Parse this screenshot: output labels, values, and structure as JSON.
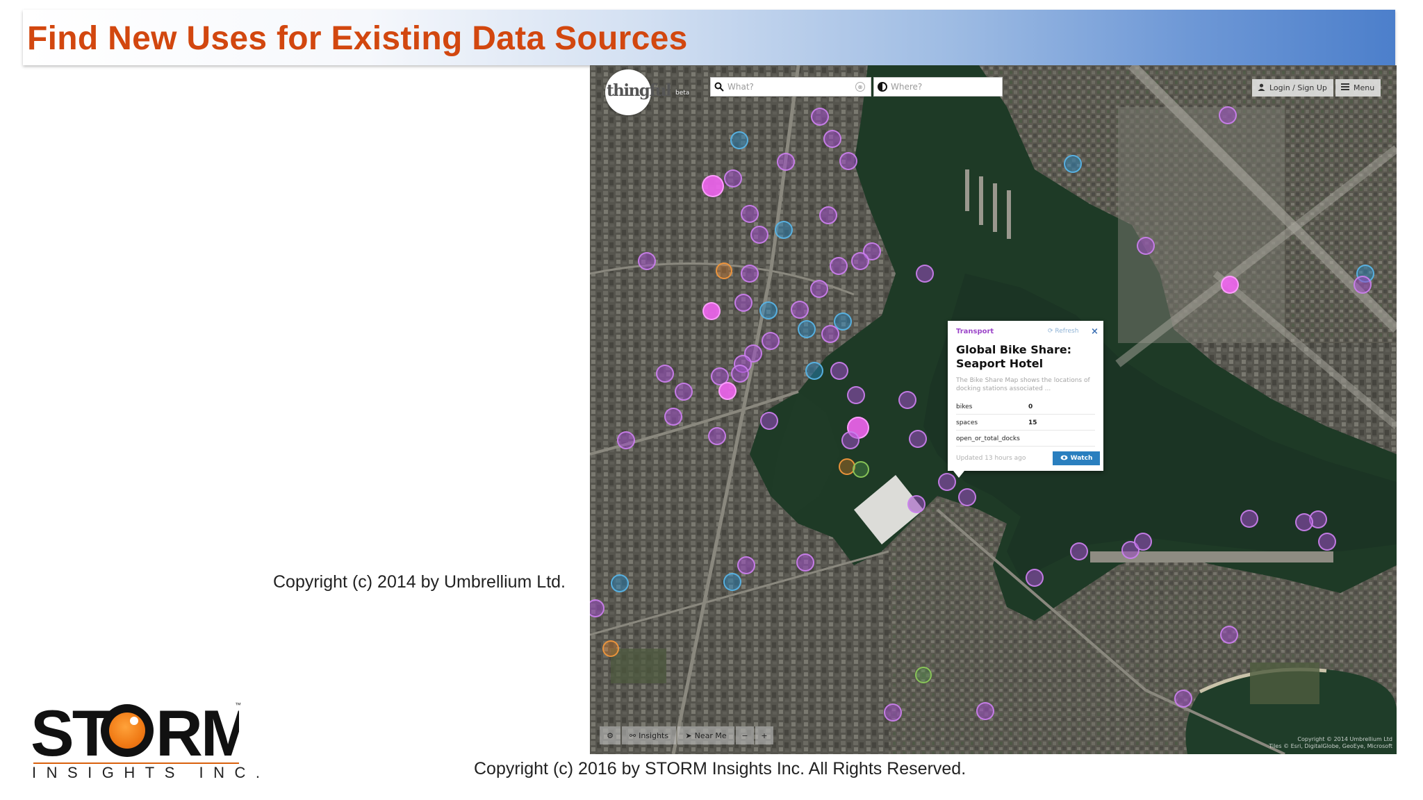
{
  "slide": {
    "title": "Find New Uses for Existing Data Sources",
    "caption_umbrellium": "Copyright (c) 2014 by Umbrellium Ltd.",
    "caption_storm": "Copyright (c) 2016 by STORM Insights Inc. All Rights Reserved."
  },
  "logo": {
    "word": "STORM",
    "tagline": "INSIGHTS INC.",
    "trademark": "™",
    "accent_color": "#f07a15"
  },
  "app": {
    "logo_text": "thingful",
    "logo_badge": "beta",
    "search": {
      "what_placeholder": "What?",
      "where_placeholder": "Where?"
    },
    "login_label": "Login / Sign Up",
    "menu_label": "Menu",
    "toolbar": {
      "insights_label": "Insights",
      "near_me_label": "Near Me",
      "zoom_out": "−",
      "zoom_in": "+"
    },
    "attribution_line1": "Copyright © 2014 Umbrellium Ltd",
    "attribution_line2": "Tiles © Esri, DigitalGlobe, GeoEye, Microsoft"
  },
  "popup": {
    "category": "Transport",
    "refresh_label": "Refresh",
    "close_glyph": "×",
    "title": "Global Bike Share: Seaport Hotel",
    "description": "The Bike Share Map shows the locations of docking stations associated ...",
    "rows": [
      {
        "key": "bikes",
        "value": "0"
      },
      {
        "key": "spaces",
        "value": "15"
      },
      {
        "key": "open_or_total_docks",
        "value": ""
      }
    ],
    "updated": "Updated 13 hours ago",
    "watch_label": "Watch"
  },
  "colors": {
    "title": "#d2470f",
    "marker_purple": "#9c4cc4",
    "marker_blue": "#288cc8",
    "marker_orange": "#e68228",
    "marker_green": "#5aa050",
    "marker_pink": "#f064f0",
    "popup_category": "#9b45c9",
    "watch_button": "#2a7fbf"
  }
}
